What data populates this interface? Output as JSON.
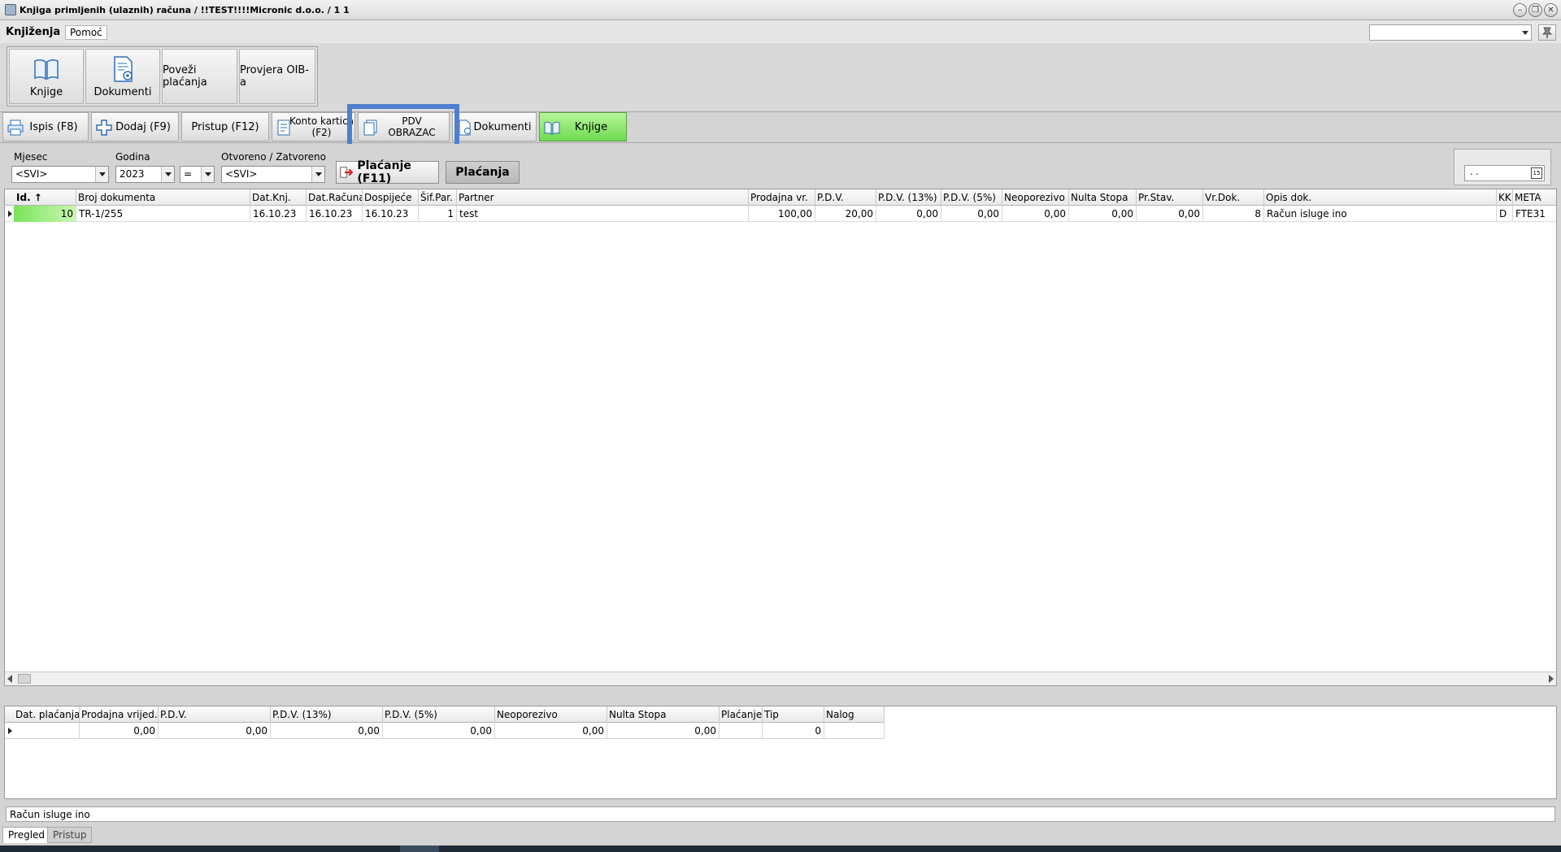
{
  "window": {
    "title": "Knjiga primljenih (ulaznih) računa / !!TEST!!!!Micronic d.o.o. / 1 1",
    "minimize": "–",
    "restore": "❐",
    "close": "✕"
  },
  "menu": {
    "active_tab": "Knjiženja",
    "other_tab": "Pomoć"
  },
  "ribbon": {
    "knjige": "Knjige",
    "dokumenti": "Dokumenti",
    "povezi": "Poveži plaćanja",
    "provjera": "Provjera OIB-a"
  },
  "toolbar": {
    "ispis": "Ispis (F8)",
    "dodaj": "Dodaj (F9)",
    "pristup": "Pristup (F12)",
    "konto_line1": "Konto kartica",
    "konto_line2": "(F2)",
    "pdv_line1": "PDV",
    "pdv_line2": "OBRAZAC",
    "dokumenti": "Dokumenti",
    "knjige": "Knjige"
  },
  "filters": {
    "mjesec_label": "Mjesec",
    "mjesec_value": "<SVI>",
    "godina_label": "Godina",
    "godina_value": "2023",
    "operator_value": "=",
    "otvoreno_label": "Otvoreno / Zatvoreno",
    "otvoreno_value": "<SVI>",
    "placanje_btn": "Plaćanje (F11)",
    "placanja_btn": "Plaćanja",
    "date_value": ". .",
    "cal_icon": "15"
  },
  "grid": {
    "headers": {
      "id": "Id. ↑",
      "broj": "Broj dokumenta",
      "datknj": "Dat.Knj.",
      "datrac": "Dat.Računa",
      "dosp": "Dospijeće",
      "sifpar": "Šif.Par.",
      "partner": "Partner",
      "prodajna": "Prodajna vr.",
      "pdv": "P.D.V.",
      "pdv13": "P.D.V. (13%)",
      "pdv5": "P.D.V. (5%)",
      "neopor": "Neoporezivo",
      "nulta": "Nulta Stopa",
      "prstav": "Pr.Stav.",
      "vrdok": "Vr.Dok.",
      "opis": "Opis dok.",
      "kk": "KK",
      "meta": "META"
    },
    "row": {
      "id": "10",
      "broj": "TR-1/255",
      "datknj": "16.10.23",
      "datrac": "16.10.23",
      "dosp": "16.10.23",
      "sifpar": "1",
      "partner": "test",
      "prodajna": "100,00",
      "pdv": "20,00",
      "pdv13": "0,00",
      "pdv5": "0,00",
      "neopor": "0,00",
      "nulta": "0,00",
      "prstav": "0,00",
      "vrdok": "8",
      "opis": "Račun isluge ino",
      "kk": "D",
      "meta": "FTE31"
    }
  },
  "payments": {
    "headers": {
      "dat": "Dat. plaćanja",
      "prod": "Prodajna vrijed.",
      "pdv": "P.D.V.",
      "pdv13": "P.D.V. (13%)",
      "pdv5": "P.D.V. (5%)",
      "neopor": "Neoporezivo",
      "nulta": "Nulta Stopa",
      "plac": "Plaćanje",
      "tip": "Tip",
      "nalog": "Nalog"
    },
    "row": {
      "dat": "",
      "prod": "0,00",
      "pdv": "0,00",
      "pdv13": "0,00",
      "pdv5": "0,00",
      "neopor": "0,00",
      "nulta": "0,00",
      "plac": "",
      "tip": "0",
      "nalog": ""
    }
  },
  "status_text": "Račun isluge ino",
  "bottom_tabs": {
    "pregled": "Pregled",
    "pristup": "Pristup"
  },
  "colors": {
    "highlight": "#4f7fd0",
    "green_button": "#6fdb50"
  }
}
